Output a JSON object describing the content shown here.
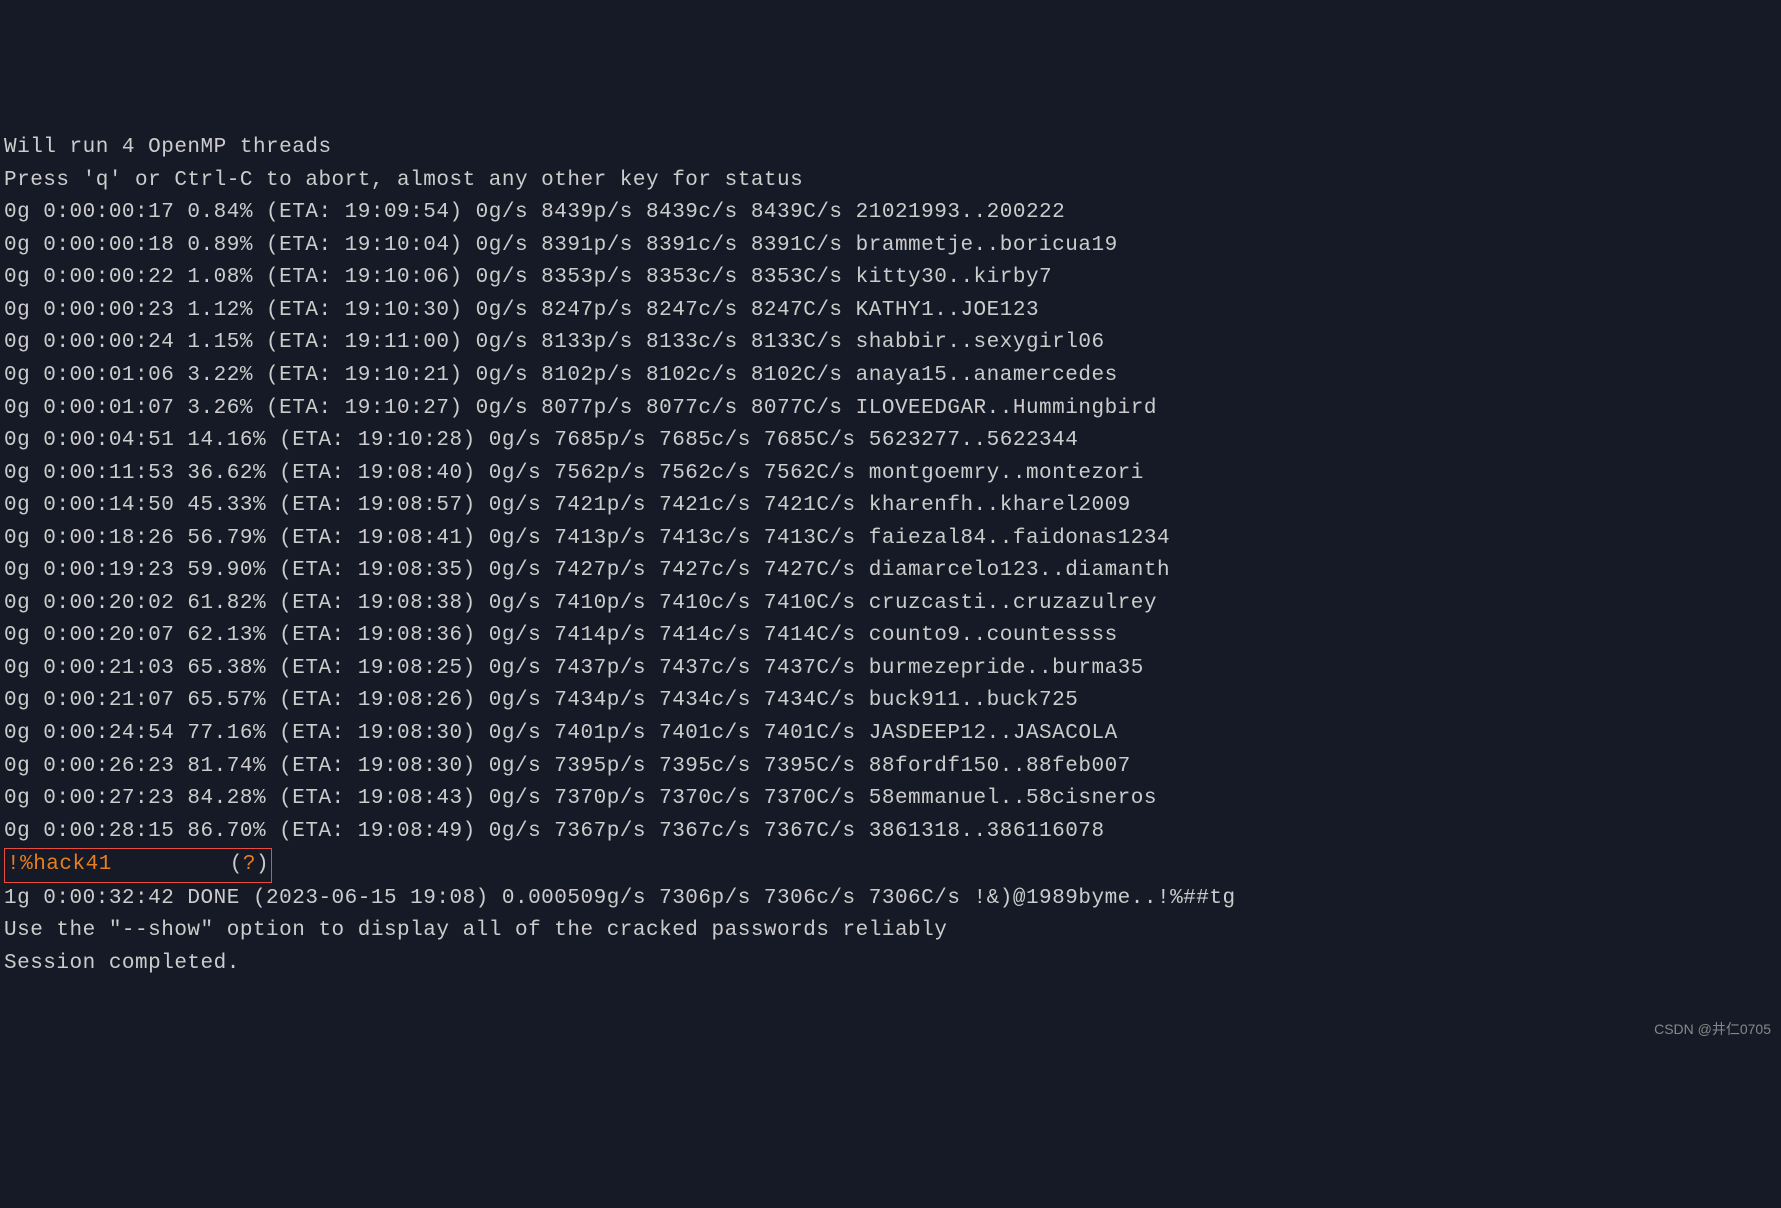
{
  "header": {
    "line1": "Will run 4 OpenMP threads",
    "line2": "Press 'q' or Ctrl-C to abort, almost any other key for status"
  },
  "progress_lines": [
    "0g 0:00:00:17 0.84% (ETA: 19:09:54) 0g/s 8439p/s 8439c/s 8439C/s 21021993..200222",
    "0g 0:00:00:18 0.89% (ETA: 19:10:04) 0g/s 8391p/s 8391c/s 8391C/s brammetje..boricua19",
    "0g 0:00:00:22 1.08% (ETA: 19:10:06) 0g/s 8353p/s 8353c/s 8353C/s kitty30..kirby7",
    "0g 0:00:00:23 1.12% (ETA: 19:10:30) 0g/s 8247p/s 8247c/s 8247C/s KATHY1..JOE123",
    "0g 0:00:00:24 1.15% (ETA: 19:11:00) 0g/s 8133p/s 8133c/s 8133C/s shabbir..sexygirl06",
    "0g 0:00:01:06 3.22% (ETA: 19:10:21) 0g/s 8102p/s 8102c/s 8102C/s anaya15..anamercedes",
    "0g 0:00:01:07 3.26% (ETA: 19:10:27) 0g/s 8077p/s 8077c/s 8077C/s ILOVEEDGAR..Hummingbird",
    "0g 0:00:04:51 14.16% (ETA: 19:10:28) 0g/s 7685p/s 7685c/s 7685C/s 5623277..5622344",
    "0g 0:00:11:53 36.62% (ETA: 19:08:40) 0g/s 7562p/s 7562c/s 7562C/s montgoemry..montezori",
    "0g 0:00:14:50 45.33% (ETA: 19:08:57) 0g/s 7421p/s 7421c/s 7421C/s kharenfh..kharel2009",
    "0g 0:00:18:26 56.79% (ETA: 19:08:41) 0g/s 7413p/s 7413c/s 7413C/s faiezal84..faidonas1234",
    "0g 0:00:19:23 59.90% (ETA: 19:08:35) 0g/s 7427p/s 7427c/s 7427C/s diamarcelo123..diamanth",
    "0g 0:00:20:02 61.82% (ETA: 19:08:38) 0g/s 7410p/s 7410c/s 7410C/s cruzcasti..cruzazulrey",
    "0g 0:00:20:07 62.13% (ETA: 19:08:36) 0g/s 7414p/s 7414c/s 7414C/s counto9..countessss",
    "0g 0:00:21:03 65.38% (ETA: 19:08:25) 0g/s 7437p/s 7437c/s 7437C/s burmezepride..burma35",
    "0g 0:00:21:07 65.57% (ETA: 19:08:26) 0g/s 7434p/s 7434c/s 7434C/s buck911..buck725",
    "0g 0:00:24:54 77.16% (ETA: 19:08:30) 0g/s 7401p/s 7401c/s 7401C/s JASDEEP12..JASACOLA",
    "0g 0:00:26:23 81.74% (ETA: 19:08:30) 0g/s 7395p/s 7395c/s 7395C/s 88fordf150..88feb007",
    "0g 0:00:27:23 84.28% (ETA: 19:08:43) 0g/s 7370p/s 7370c/s 7370C/s 58emmanuel..58cisneros",
    "0g 0:00:28:15 86.70% (ETA: 19:08:49) 0g/s 7367p/s 7367c/s 7367C/s 3861318..386116078"
  ],
  "cracked": {
    "password": "!%hack41",
    "user_hint": "?",
    "spaces": "         "
  },
  "footer": {
    "done_line": "1g 0:00:32:42 DONE (2023-06-15 19:08) 0.000509g/s 7306p/s 7306c/s 7306C/s !&)@1989byme..!%##tg",
    "show_hint": "Use the \"--show\" option to display all of the cracked passwords reliably",
    "session": "Session completed."
  },
  "watermark": "CSDN @井仁0705"
}
